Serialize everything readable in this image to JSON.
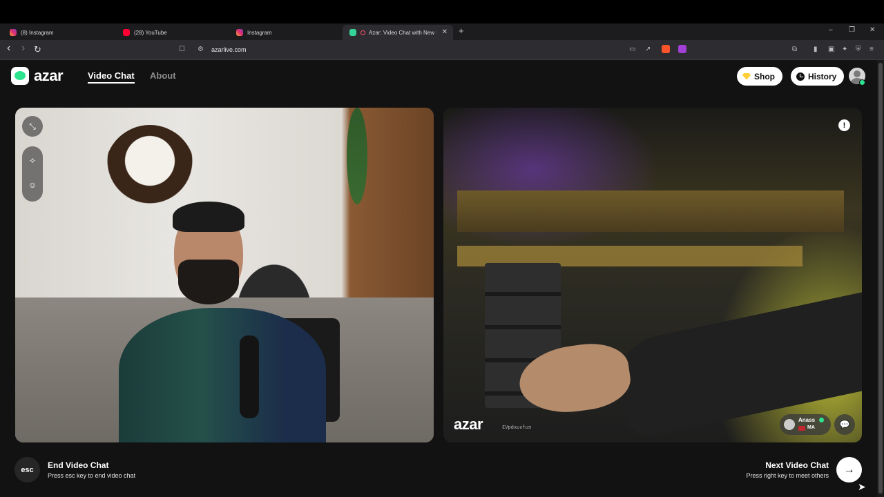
{
  "browser": {
    "tabs": [
      {
        "title": "(8) Instagram",
        "icon": "instagram-icon"
      },
      {
        "title": "(28) YouTube",
        "icon": "youtube-icon"
      },
      {
        "title": "Instagram",
        "icon": "instagram-icon"
      },
      {
        "title": "Azar: Video Chat with New Pe",
        "icon": "azar-icon",
        "active": true
      }
    ],
    "new_tab": "+",
    "window_controls": {
      "minimize": "–",
      "restore": "❐",
      "close": "✕"
    },
    "nav": {
      "back": "‹",
      "forward": "›",
      "reload": "↻"
    },
    "url": "azarlive.com"
  },
  "site": {
    "logo_text": "azar",
    "nav": {
      "video_chat": "Video Chat",
      "about": "About"
    },
    "buttons": {
      "shop": "Shop",
      "history": "History"
    }
  },
  "remote": {
    "watermark": "azar",
    "watermark_id": "eufsuxbqV3",
    "user_name": "Anass",
    "user_country": "MA",
    "report_symbol": "!"
  },
  "controls": {
    "esc_label": "esc",
    "end_title": "End Video Chat",
    "end_sub": "Press esc key to end video chat",
    "next_title": "Next Video Chat",
    "next_sub": "Press right key to meet others",
    "next_arrow": "→"
  },
  "colors": {
    "accent": "#2de38e",
    "shop_gem": "#ffcf3a",
    "page_bg": "#121212"
  }
}
